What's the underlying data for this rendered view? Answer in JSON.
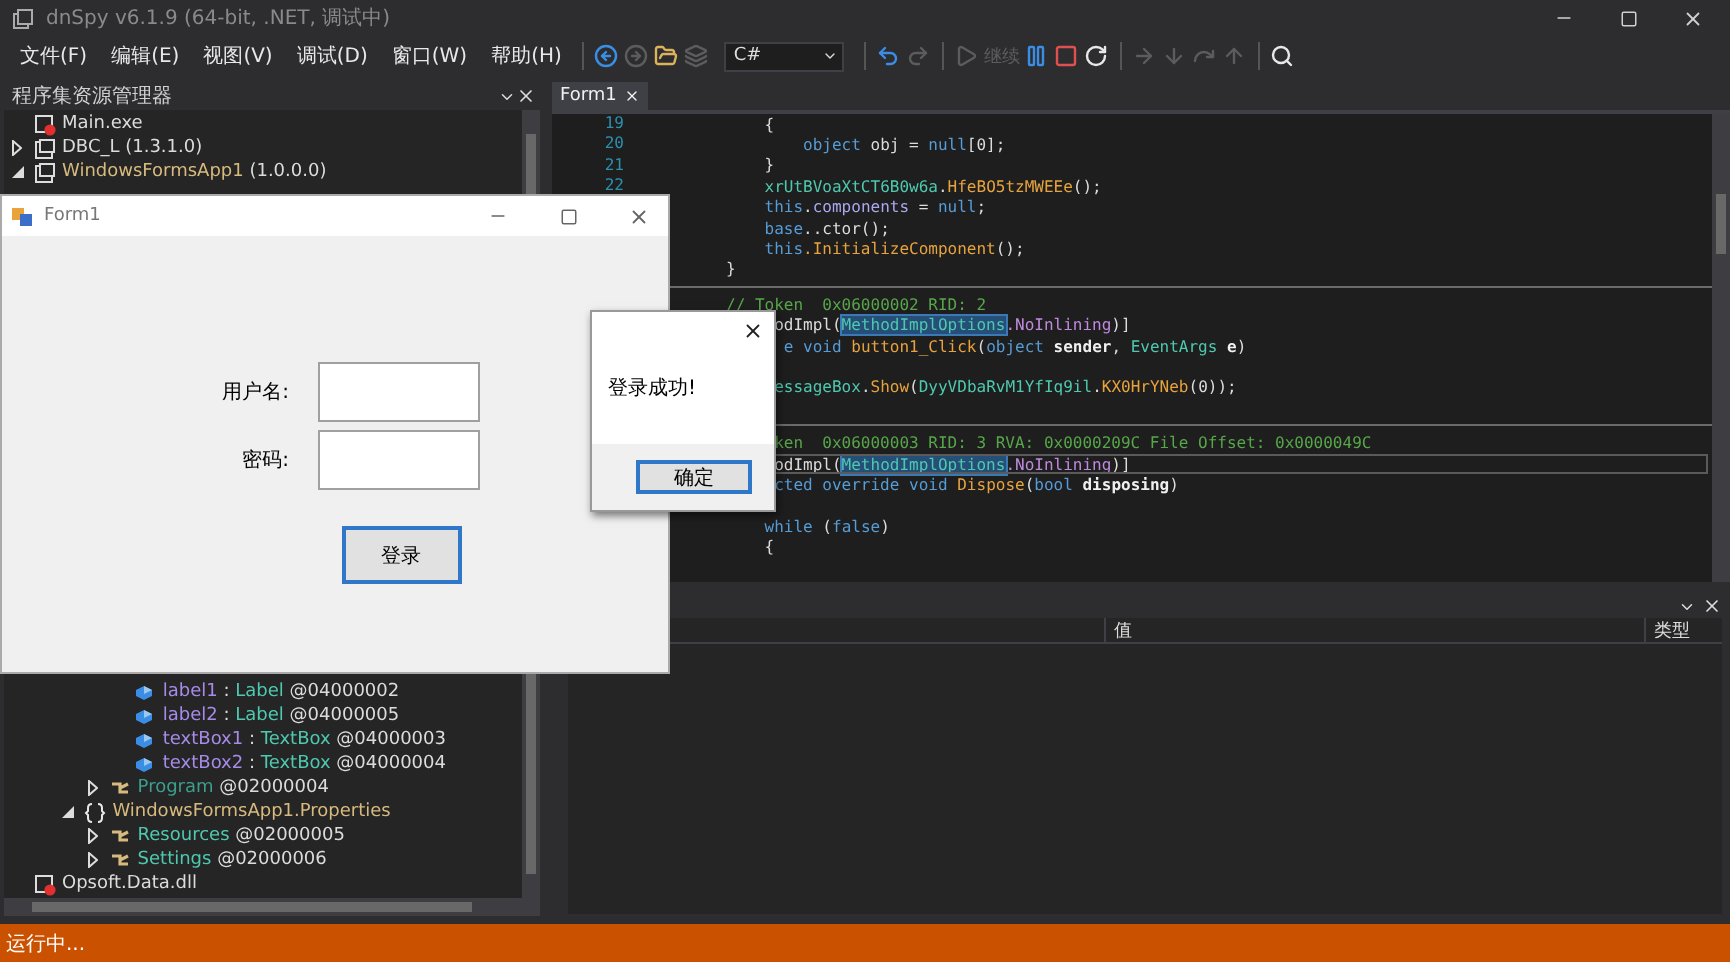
{
  "window": {
    "title": "dnSpy v6.1.9 (64-bit, .NET, 调试中)"
  },
  "menu": [
    "文件(F)",
    "编辑(E)",
    "视图(V)",
    "调试(D)",
    "窗口(W)",
    "帮助(H)"
  ],
  "toolbar": [
    {
      "kind": "back",
      "disabled": false
    },
    {
      "kind": "forward",
      "disabled": true
    },
    {
      "kind": "open",
      "disabled": false
    },
    {
      "kind": "open-list",
      "disabled": true
    },
    {
      "kind": "language",
      "value": "C#"
    },
    {
      "kind": "undo",
      "disabled": false
    },
    {
      "kind": "redo",
      "disabled": true
    },
    {
      "kind": "continue",
      "label": "继续",
      "disabled": true
    },
    {
      "kind": "pause",
      "disabled": false
    },
    {
      "kind": "stop",
      "disabled": false
    },
    {
      "kind": "restart",
      "disabled": false
    },
    {
      "kind": "step-next",
      "disabled": true
    },
    {
      "kind": "step-into",
      "disabled": true
    },
    {
      "kind": "step-over",
      "disabled": true
    },
    {
      "kind": "step-out",
      "disabled": true
    },
    {
      "kind": "search",
      "disabled": false
    }
  ],
  "explorer": {
    "title": "程序集资源管理器",
    "tree": [
      {
        "kind": "assembly-error",
        "label": [
          {
            "kind": "plain",
            "text": "Main.exe"
          }
        ]
      },
      {
        "kind": "assembly",
        "expanded": false,
        "label": [
          {
            "kind": "plain",
            "text": "DBC_L (1.3.1.0)"
          }
        ]
      },
      {
        "kind": "assembly",
        "expanded": true,
        "label": [
          {
            "kind": "namespace",
            "text": "WindowsFormsApp1"
          },
          {
            "kind": "plain",
            "text": " (1.0.0.0)"
          }
        ],
        "children": [
          {
            "children": [
              {
                "children": [
                  {
                    "children": [
                      {
                        "kind": "field",
                        "label": [
                          {
                            "kind": "field",
                            "text": "label1"
                          },
                          {
                            "kind": "plain",
                            "text": " : "
                          },
                          {
                            "kind": "type",
                            "text": "Label"
                          },
                          {
                            "kind": "plain",
                            "text": " @04000002"
                          }
                        ]
                      },
                      {
                        "kind": "field",
                        "label": [
                          {
                            "kind": "field",
                            "text": "label2"
                          },
                          {
                            "kind": "plain",
                            "text": " : "
                          },
                          {
                            "kind": "type",
                            "text": "Label"
                          },
                          {
                            "kind": "plain",
                            "text": " @04000005"
                          }
                        ]
                      },
                      {
                        "kind": "field",
                        "label": [
                          {
                            "kind": "field",
                            "text": "textBox1"
                          },
                          {
                            "kind": "plain",
                            "text": " : "
                          },
                          {
                            "kind": "type",
                            "text": "TextBox"
                          },
                          {
                            "kind": "plain",
                            "text": " @04000003"
                          }
                        ]
                      },
                      {
                        "kind": "field",
                        "label": [
                          {
                            "kind": "field",
                            "text": "textBox2"
                          },
                          {
                            "kind": "plain",
                            "text": " : "
                          },
                          {
                            "kind": "type",
                            "text": "TextBox"
                          },
                          {
                            "kind": "plain",
                            "text": " @04000004"
                          }
                        ]
                      }
                    ]
                  },
                  {
                    "kind": "class",
                    "expanded": false,
                    "label": [
                      {
                        "kind": "internal",
                        "text": "Program"
                      },
                      {
                        "kind": "plain",
                        "text": " @02000004"
                      }
                    ]
                  }
                ]
              },
              {
                "kind": "namespace",
                "expanded": true,
                "label": [
                  {
                    "kind": "namespace",
                    "text": "WindowsFormsApp1.Properties"
                  }
                ],
                "children": [
                  {
                    "kind": "class",
                    "expanded": false,
                    "label": [
                      {
                        "kind": "type",
                        "text": "Resources"
                      },
                      {
                        "kind": "plain",
                        "text": " @02000005"
                      }
                    ]
                  },
                  {
                    "kind": "class",
                    "expanded": false,
                    "label": [
                      {
                        "kind": "type",
                        "text": "Settings"
                      },
                      {
                        "kind": "plain",
                        "text": " @02000006"
                      }
                    ]
                  }
                ]
              }
            ]
          }
        ]
      },
      {
        "kind": "assembly-error",
        "label": [
          {
            "kind": "plain",
            "text": "Opsoft.Data.dll"
          }
        ]
      }
    ]
  },
  "editor": {
    "tab": "Form1",
    "lines": [
      {
        "kind": "code",
        "number": "19",
        "current": false,
        "segments": [
          {
            "kind": "plain",
            "text": "    {"
          }
        ]
      },
      {
        "kind": "code",
        "number": "20",
        "current": false,
        "segments": [
          {
            "kind": "keyword",
            "text": "        object"
          },
          {
            "kind": "plain",
            "text": " obj = "
          },
          {
            "kind": "keyword",
            "text": "null"
          },
          {
            "kind": "plain",
            "text": "[0];"
          }
        ]
      },
      {
        "kind": "code",
        "number": "21",
        "current": false,
        "segments": [
          {
            "kind": "plain",
            "text": "    }"
          }
        ]
      },
      {
        "kind": "code",
        "number": "22",
        "current": false,
        "segments": [
          {
            "kind": "type",
            "text": "    xrUtBVoaXtCT6B0w6a"
          },
          {
            "kind": "plain",
            "text": "."
          },
          {
            "kind": "method",
            "text": "HfeBO5tzMWEEe"
          },
          {
            "kind": "plain",
            "text": "();"
          }
        ]
      },
      {
        "kind": "code",
        "current": false,
        "segments": [
          {
            "kind": "keyword",
            "text": "    this"
          },
          {
            "kind": "plain",
            "text": "."
          },
          {
            "kind": "field",
            "text": "components"
          },
          {
            "kind": "plain",
            "text": " = "
          },
          {
            "kind": "keyword",
            "text": "null"
          },
          {
            "kind": "plain",
            "text": ";"
          }
        ]
      },
      {
        "kind": "code",
        "current": false,
        "segments": [
          {
            "kind": "keyword",
            "text": "    base"
          },
          {
            "kind": "plain",
            "text": "..ctor();"
          }
        ]
      },
      {
        "kind": "code",
        "current": false,
        "segments": [
          {
            "kind": "keyword",
            "text": "    this"
          },
          {
            "kind": "method",
            "text": ".InitializeComponent"
          },
          {
            "kind": "plain",
            "text": "();"
          }
        ]
      },
      {
        "kind": "code",
        "current": false,
        "segments": [
          {
            "kind": "plain",
            "text": "}"
          }
        ]
      },
      {
        "kind": "separator"
      },
      {
        "kind": "code",
        "current": false,
        "segments": [
          {
            "kind": "comment",
            "text": "// Token  0x06000002 RID: 2"
          }
        ]
      },
      {
        "kind": "code",
        "current": false,
        "segments": [
          {
            "kind": "plain",
            "text": "     odImpl("
          },
          {
            "kind": "reference",
            "text": "MethodImplOptions"
          },
          {
            "kind": "enum",
            "text": ".NoInlining"
          },
          {
            "kind": "plain",
            "text": ")]"
          }
        ]
      },
      {
        "kind": "code",
        "current": false,
        "segments": [
          {
            "kind": "keyword",
            "text": "      e"
          },
          {
            "kind": "keyword",
            "text": " void"
          },
          {
            "kind": "method",
            "text": " button1_Click"
          },
          {
            "kind": "plain",
            "text": "("
          },
          {
            "kind": "keyword",
            "text": "object"
          },
          {
            "kind": "param",
            "text": " sender"
          },
          {
            "kind": "plain",
            "text": ", "
          },
          {
            "kind": "type",
            "text": "EventArgs"
          },
          {
            "kind": "param",
            "text": " e"
          },
          {
            "kind": "plain",
            "text": ")"
          }
        ]
      },
      {
        "kind": "covered"
      },
      {
        "kind": "code",
        "current": false,
        "segments": [
          {
            "kind": "type",
            "text": "     essageBox"
          },
          {
            "kind": "plain",
            "text": "."
          },
          {
            "kind": "method",
            "text": "Show"
          },
          {
            "kind": "plain",
            "text": "("
          },
          {
            "kind": "type",
            "text": "DyyVDbaRvM1YfIq9il"
          },
          {
            "kind": "plain",
            "text": "."
          },
          {
            "kind": "method",
            "text": "KX0HrYNeb"
          },
          {
            "kind": "plain",
            "text": "(0));"
          }
        ]
      },
      {
        "kind": "covered"
      },
      {
        "kind": "separator"
      },
      {
        "kind": "code",
        "current": false,
        "segments": [
          {
            "kind": "comment",
            "text": "     ken  0x06000003 RID: 3 RVA: 0x0000209C File Offset: 0x0000049C"
          }
        ]
      },
      {
        "kind": "code",
        "current": true,
        "segments": [
          {
            "kind": "plain",
            "text": "     odImpl("
          },
          {
            "kind": "reference",
            "text": "MethodImplOptions"
          },
          {
            "kind": "enum",
            "text": ".NoInlining"
          },
          {
            "kind": "plain",
            "text": ")]"
          }
        ]
      },
      {
        "kind": "code",
        "current": false,
        "segments": [
          {
            "kind": "keyword",
            "text": "     cted"
          },
          {
            "kind": "keyword",
            "text": " override"
          },
          {
            "kind": "keyword",
            "text": " void"
          },
          {
            "kind": "method",
            "text": " Dispose"
          },
          {
            "kind": "plain",
            "text": "("
          },
          {
            "kind": "keyword",
            "text": "bool"
          },
          {
            "kind": "param",
            "text": " disposing"
          },
          {
            "kind": "plain",
            "text": ")"
          }
        ]
      },
      {
        "kind": "covered"
      },
      {
        "kind": "code",
        "current": false,
        "segments": [
          {
            "kind": "keyword",
            "text": "    while"
          },
          {
            "kind": "plain",
            "text": " ("
          },
          {
            "kind": "keyword",
            "text": "false"
          },
          {
            "kind": "plain",
            "text": ")"
          }
        ]
      },
      {
        "kind": "code",
        "current": false,
        "segments": [
          {
            "kind": "plain",
            "text": "    {"
          }
        ]
      }
    ]
  },
  "bottom_panel": {
    "columns": [
      "值",
      "类型"
    ]
  },
  "status_bar": "运行中...",
  "form1": {
    "title": "Form1",
    "fields": [
      {
        "label": "用户名:"
      },
      {
        "label": "密码:"
      }
    ],
    "button": "登录"
  },
  "message_box": {
    "text": "登录成功!",
    "button": "确定"
  }
}
